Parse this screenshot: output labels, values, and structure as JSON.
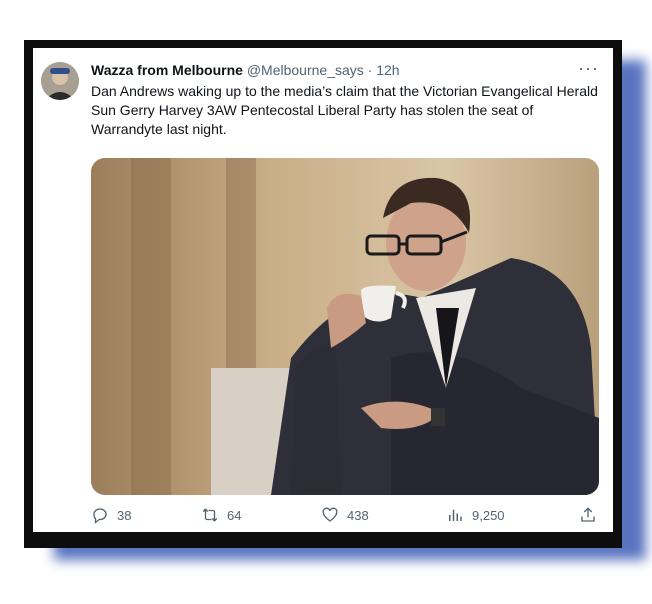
{
  "tweet": {
    "author_name": "Wazza from Melbourne",
    "handle": "@Melbourne_says",
    "separator": " · ",
    "time": "12h",
    "more": "···",
    "text": "Dan Andrews waking up to the media’s claim that the Victorian Evangelical Herald Sun Gerry Harvey 3AW Pentecostal Liberal Party has stolen the seat of Warrandyte last night."
  },
  "actions": {
    "replies": "38",
    "retweets": "64",
    "likes": "438",
    "views": "9,250"
  },
  "icons": {
    "reply": "reply-icon",
    "retweet": "retweet-icon",
    "like": "heart-icon",
    "views": "views-icon",
    "share": "share-icon",
    "more": "more-icon"
  },
  "colors": {
    "frame": "#0d0d0d",
    "shadow": "#3b5bb5",
    "text": "#0f1419",
    "muted": "#536471"
  }
}
